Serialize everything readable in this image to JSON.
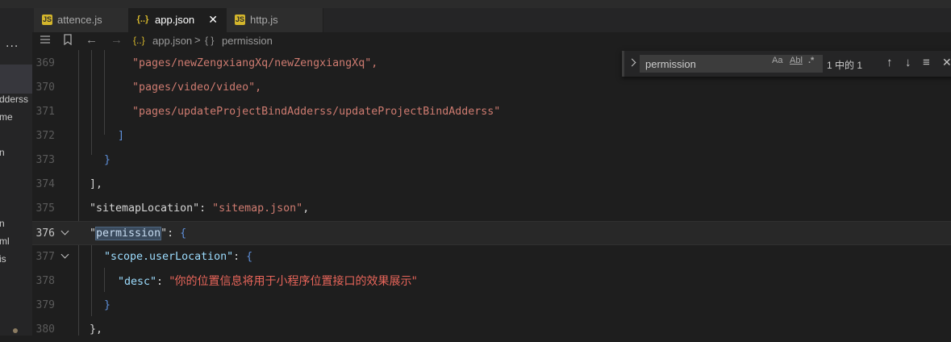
{
  "tabs": [
    {
      "label": "attence.js",
      "icon": "js-file-icon",
      "active": false
    },
    {
      "label": "app.json",
      "icon": "json-file-icon",
      "active": true
    },
    {
      "label": "http.js",
      "icon": "js-file-icon",
      "active": false
    }
  ],
  "breadcrumb": {
    "file_icon": "{..}",
    "file": "app.json",
    "separator": ">",
    "symbol_icon": "{ }",
    "symbol": "permission"
  },
  "sidebar": {
    "more": "...",
    "fragments": [
      "dderss",
      "me",
      "n",
      "n",
      "ml",
      "is"
    ]
  },
  "editor": {
    "lines": [
      {
        "number": "369",
        "text": "\"pages/newZengxiangXq/newZengxiangXq\","
      },
      {
        "number": "370",
        "text": "\"pages/video/video\","
      },
      {
        "number": "371",
        "text": "\"pages/updateProjectBindAdderss/updateProjectBindAdderss\""
      },
      {
        "number": "372",
        "text": "]"
      },
      {
        "number": "373",
        "text": "}"
      },
      {
        "number": "374",
        "text": "],"
      },
      {
        "number": "375",
        "key": "\"sitemapLocation\"",
        "value": "\"sitemap.json\""
      },
      {
        "number": "376",
        "key_quote": "\"",
        "key_match": "permission",
        "key_end": "\"",
        "brace": "{"
      },
      {
        "number": "377",
        "key": "\"scope.userLocation\"",
        "brace": "{"
      },
      {
        "number": "378",
        "key": "\"desc\"",
        "value": "\"你的位置信息将用于小程序位置接口的效果展示\""
      },
      {
        "number": "379",
        "text": "}"
      },
      {
        "number": "380",
        "text": "},"
      }
    ]
  },
  "find": {
    "query": "permission",
    "match_case": "Aa",
    "whole_word": "Abl",
    "regex": ".*",
    "result": "1 中的 1",
    "prev_icon": "↑",
    "next_icon": "↓",
    "selection_icon": "≡",
    "close_icon": "✕"
  }
}
